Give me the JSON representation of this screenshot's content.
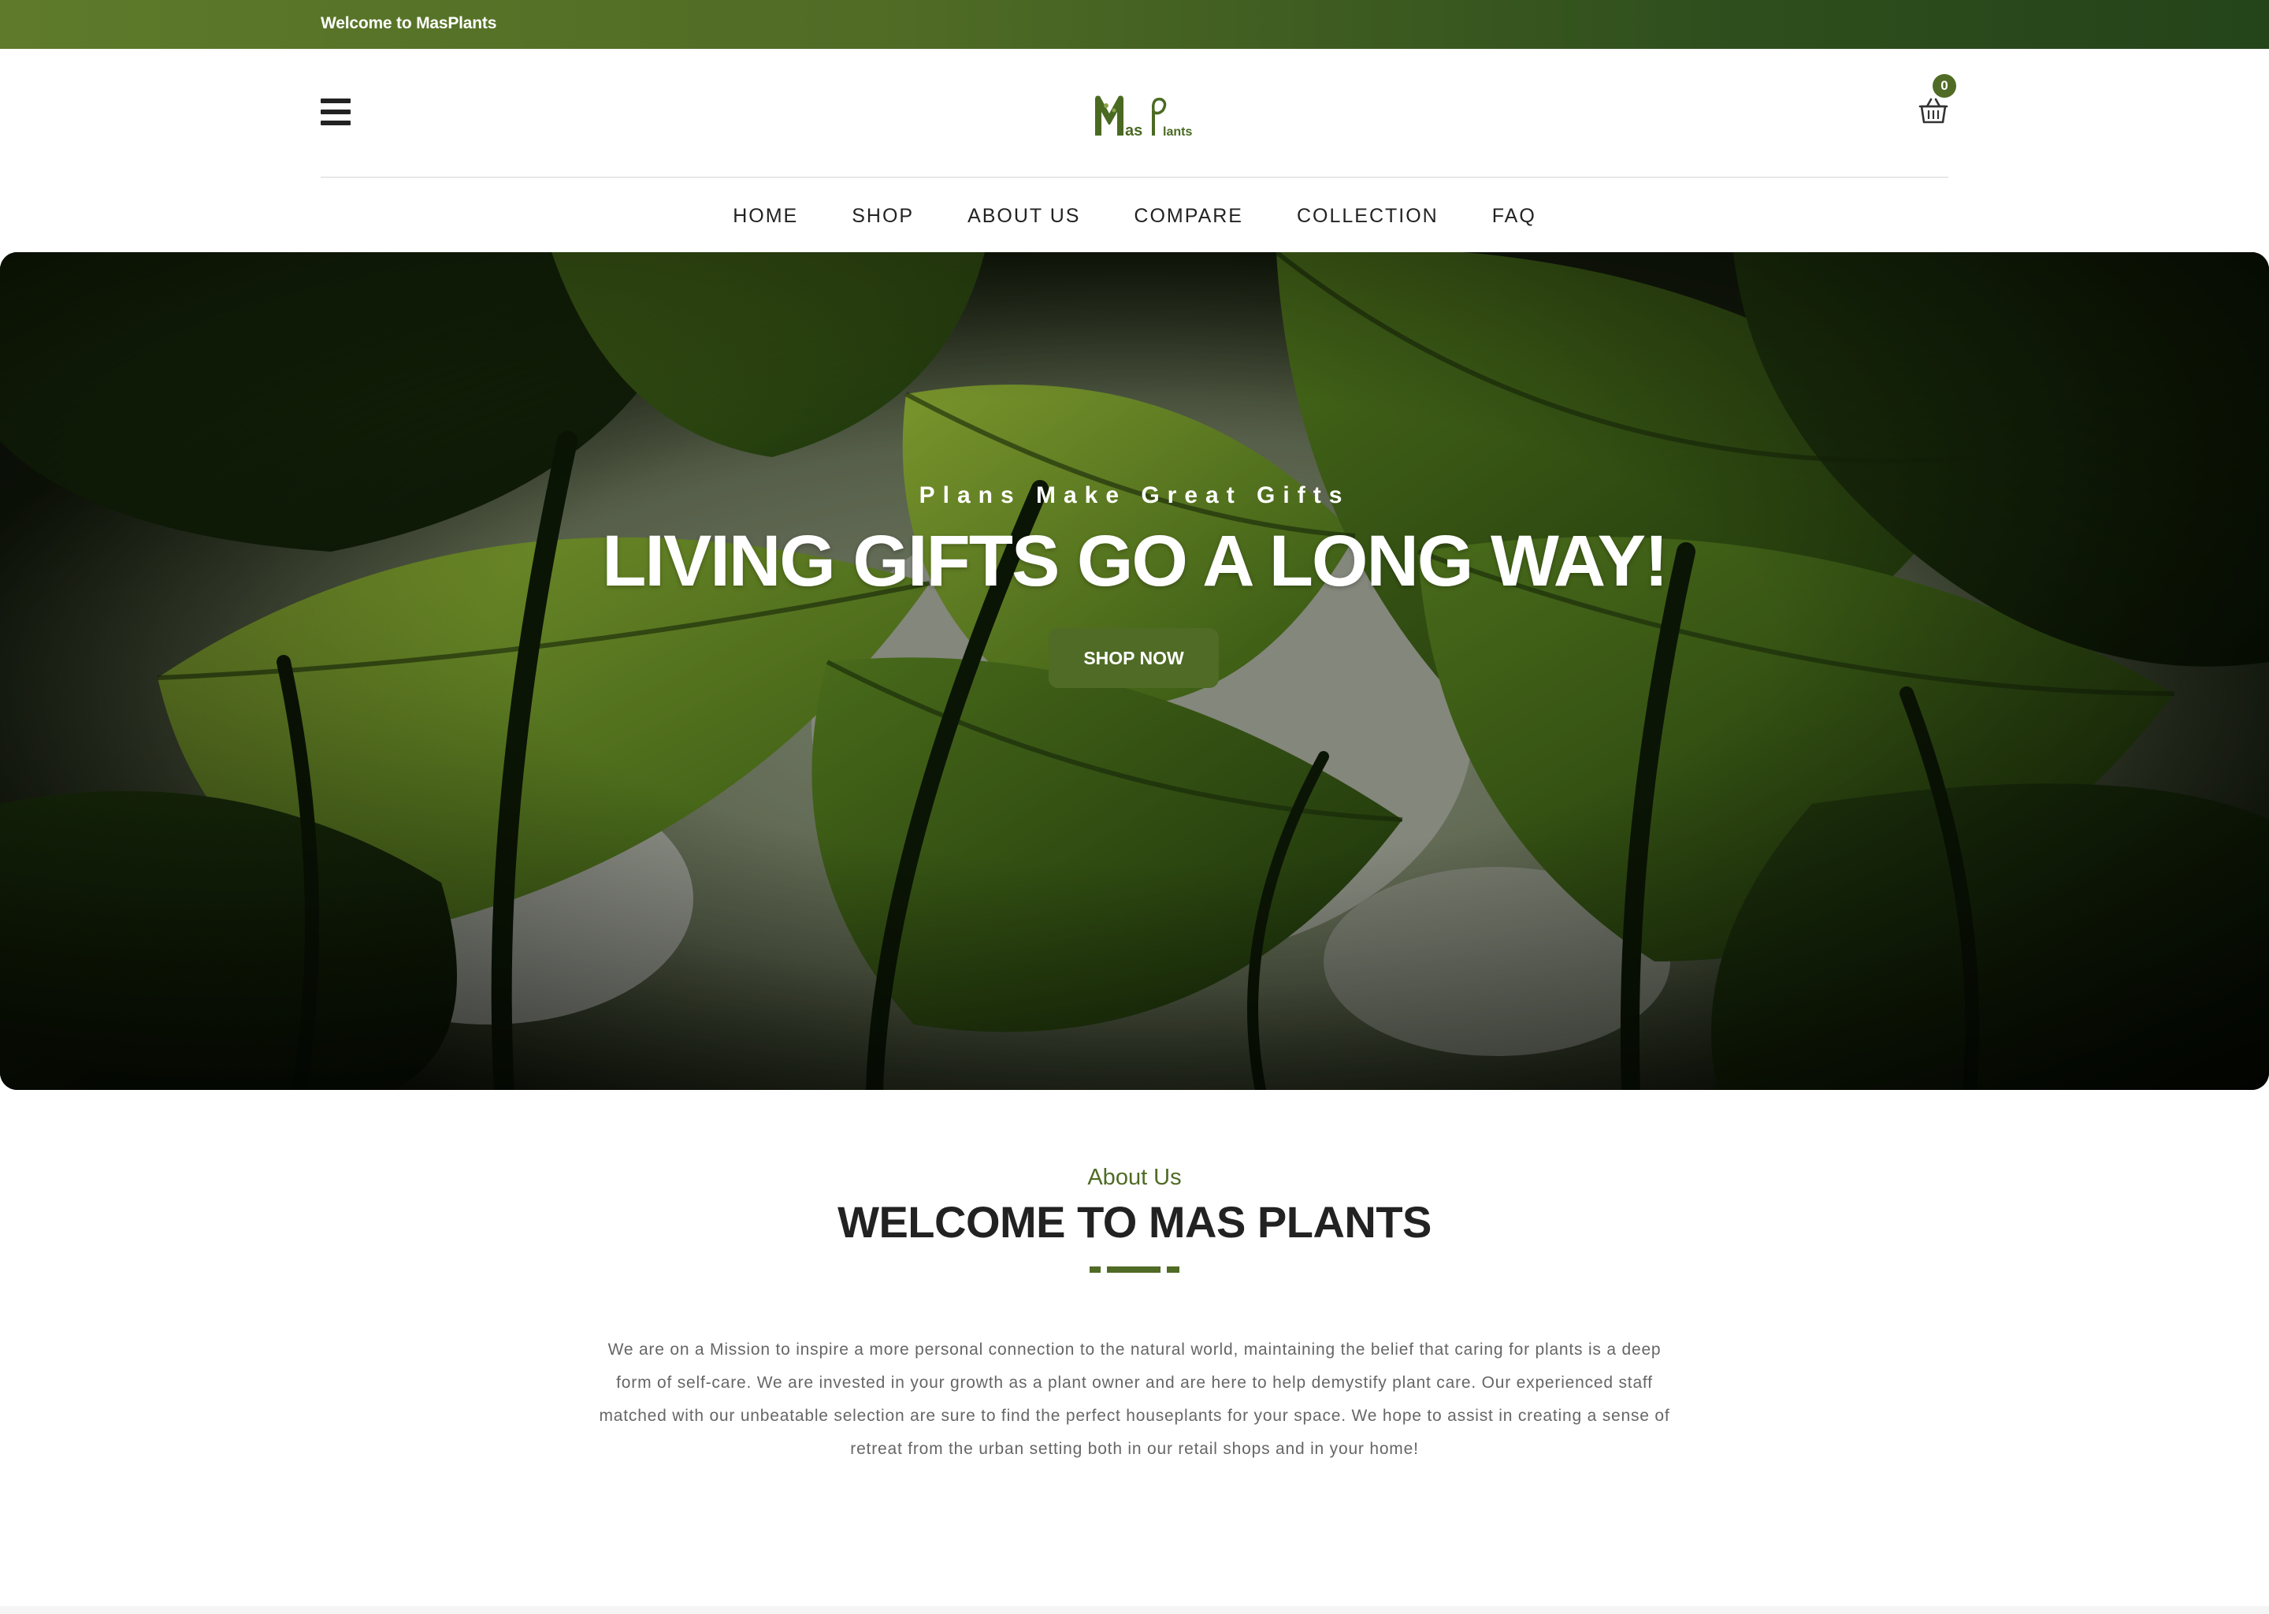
{
  "topbar": {
    "welcome_text": "Welcome to MasPlants"
  },
  "header": {
    "logo_text": "MasPlants",
    "cart_count": "0",
    "icons": {
      "menu": "hamburger-menu-icon",
      "cart": "shopping-basket-icon"
    }
  },
  "nav": {
    "items": [
      {
        "label": "HOME"
      },
      {
        "label": "SHOP"
      },
      {
        "label": "ABOUT US"
      },
      {
        "label": "COMPARE"
      },
      {
        "label": "COLLECTION"
      },
      {
        "label": "FAQ"
      }
    ]
  },
  "hero": {
    "subtitle": "Plans Make Great Gifts",
    "title": "LIVING GIFTS GO A LONG WAY!",
    "button_label": "SHOP NOW"
  },
  "about": {
    "eyebrow": "About Us",
    "title": "WELCOME TO MAS PLANTS",
    "body": "We are on a Mission to inspire a more personal connection to the natural world, maintaining the belief that caring for plants is a deep form of self-care. We are invested in your growth as a plant owner and are here to help demystify plant care. Our experienced staff matched with our unbeatable selection are sure to find the perfect houseplants for your space. We hope to assist in creating a sense of retreat from the urban setting both in our retail shops and in your home!"
  },
  "colors": {
    "brand_green": "#4f6b25",
    "topbar_dark": "#24441a",
    "text_dark": "#222222",
    "text_muted": "#666666"
  }
}
